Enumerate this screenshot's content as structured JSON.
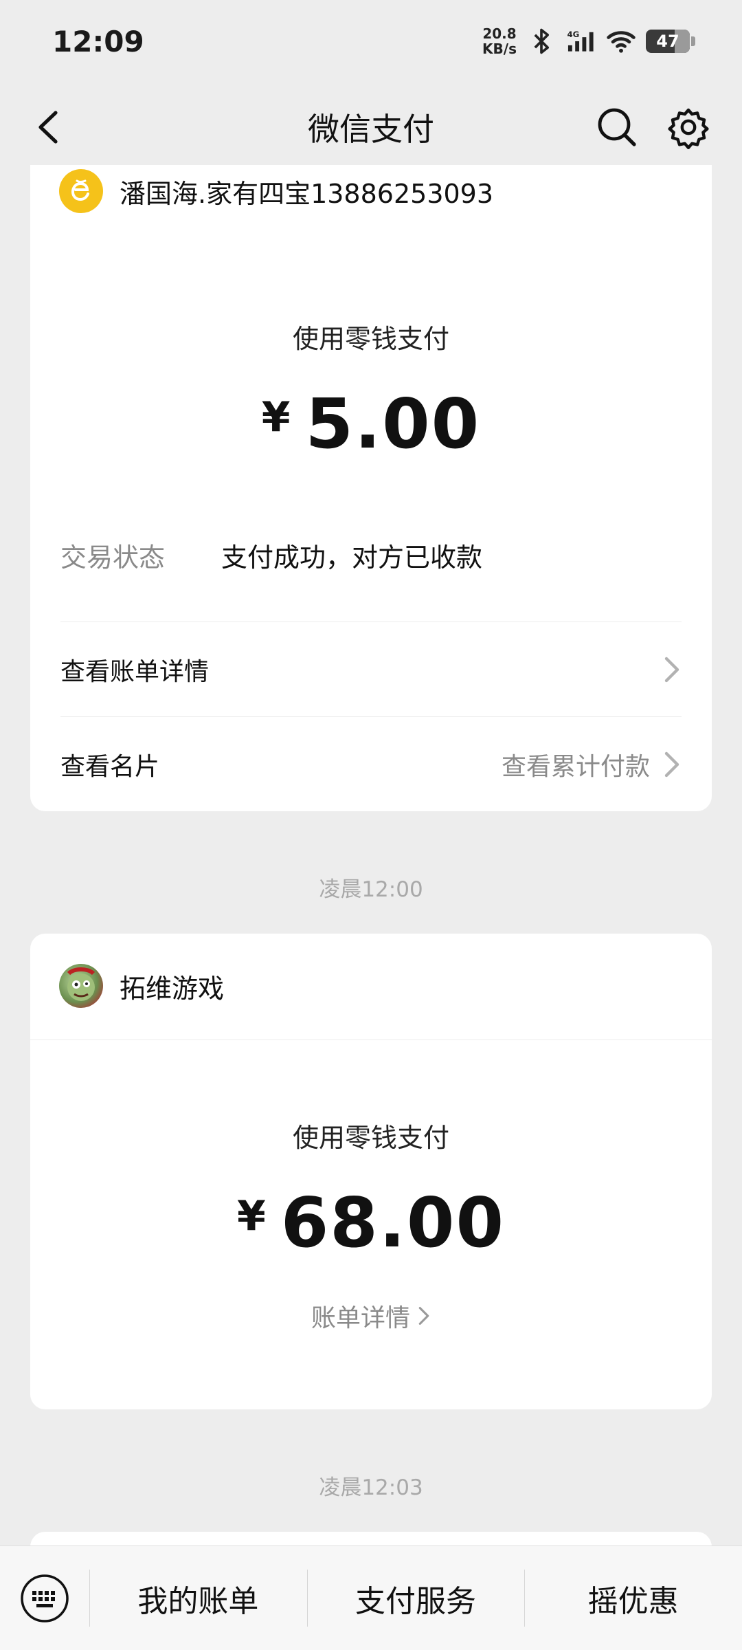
{
  "status_bar": {
    "time": "12:09",
    "net_speed_value": "20.8",
    "net_speed_unit": "KB/s",
    "signal_label": "4G",
    "battery": "47"
  },
  "nav": {
    "title": "微信支付"
  },
  "transactions": [
    {
      "merchant": "潘国海.家有四宝13886253093",
      "pay_method": "使用零钱支付",
      "currency": "¥",
      "amount": "5.00",
      "status_label": "交易状态",
      "status_value": "支付成功，对方已收款",
      "rows": [
        {
          "label": "查看账单详情",
          "right": ""
        },
        {
          "label": "查看名片",
          "right": "查看累计付款"
        }
      ]
    },
    {
      "time": "凌晨12:00",
      "merchant": "拓维游戏",
      "pay_method": "使用零钱支付",
      "currency": "¥",
      "amount": "68.00",
      "detail_link": "账单详情"
    },
    {
      "time": "凌晨12:03"
    }
  ],
  "bottom_bar": {
    "tabs": [
      "我的账单",
      "支付服务",
      "摇优惠"
    ]
  },
  "colors": {
    "background": "#ededed",
    "card": "#ffffff",
    "secondary_text": "#8a8a8a",
    "merchant_logo": "#f5c21a"
  }
}
